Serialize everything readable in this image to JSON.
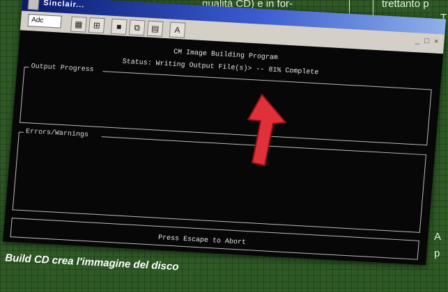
{
  "magazine": {
    "col1_text": "qualità CD) e in for-",
    "col2_text": "trettanto p",
    "col2_line2": "T",
    "side_right_1": "A",
    "side_right_2": "p"
  },
  "window": {
    "title": "Sinclair...",
    "combo_value": "Adc",
    "toolbar_icons": [
      "grid-icon",
      "layout-icon",
      "fullscreen-icon",
      "copy-icon",
      "paste-icon",
      "font-icon"
    ],
    "controls": "_ □ ×"
  },
  "console": {
    "program_title": "CM Image Building Program",
    "status_line": "Status: Writing Output File(s)> -- 81% Complete",
    "panel1_label": "Output Progress",
    "panel2_label": "Errors/Warnings",
    "footer": "Press Escape to Abort"
  },
  "caption": {
    "text": "Build CD crea l'immagine del disco"
  },
  "colors": {
    "background": "#2f5a26",
    "console_bg": "#070707",
    "arrow": "#e0303a"
  }
}
